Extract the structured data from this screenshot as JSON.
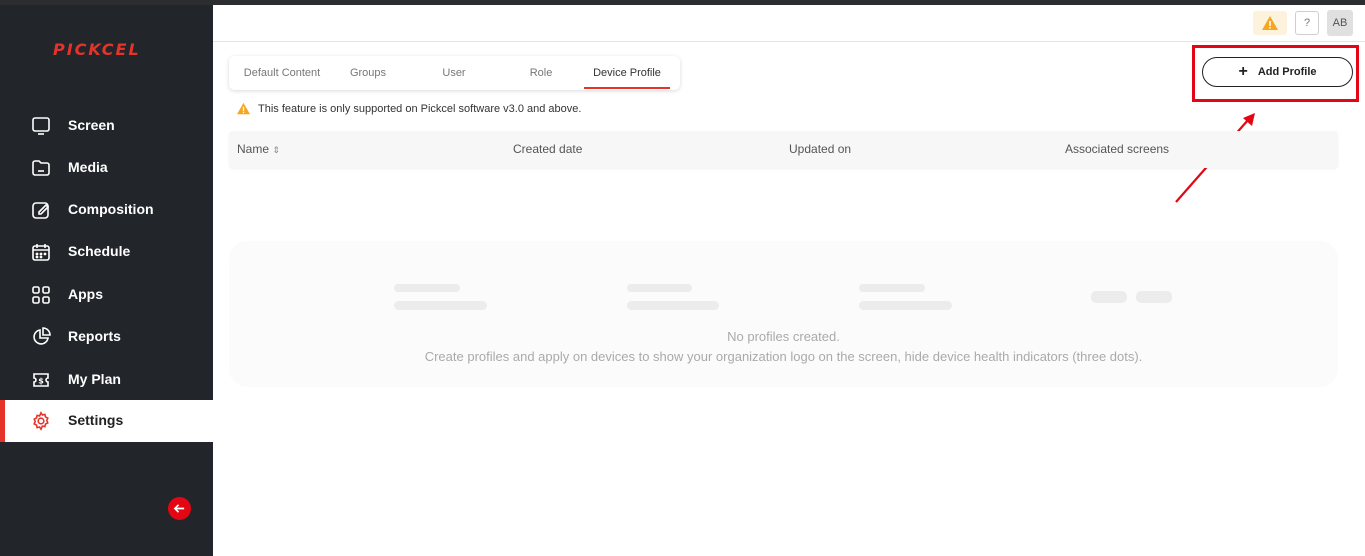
{
  "app": {
    "logo": "PICKCEL"
  },
  "sidebar": {
    "items": [
      {
        "label": "Screen",
        "icon": "monitor-icon"
      },
      {
        "label": "Media",
        "icon": "folder-icon"
      },
      {
        "label": "Composition",
        "icon": "edit-icon"
      },
      {
        "label": "Schedule",
        "icon": "calendar-icon"
      },
      {
        "label": "Apps",
        "icon": "apps-grid-icon"
      },
      {
        "label": "Reports",
        "icon": "pie-chart-icon"
      },
      {
        "label": "My Plan",
        "icon": "plan-icon"
      },
      {
        "label": "Settings",
        "icon": "gear-icon",
        "active": true
      }
    ]
  },
  "header": {
    "help": "?",
    "avatar": "AB"
  },
  "tabs": [
    {
      "label": "Default Content"
    },
    {
      "label": "Groups"
    },
    {
      "label": "User"
    },
    {
      "label": "Role"
    },
    {
      "label": "Device Profile",
      "active": true
    }
  ],
  "toolbar": {
    "add_label": "Add Profile"
  },
  "notice": "This feature is only supported on Pickcel software v3.0 and above.",
  "table": {
    "columns": [
      "Name",
      "Created date",
      "Updated on",
      "Associated screens"
    ]
  },
  "empty_state": {
    "title": "No profiles created.",
    "description": "Create profiles and apply on devices to show your organization logo on the screen, hide device health indicators (three dots)."
  },
  "colors": {
    "accent": "#e6332a",
    "sidebar_bg": "#22252a",
    "warning": "#f5a623"
  }
}
